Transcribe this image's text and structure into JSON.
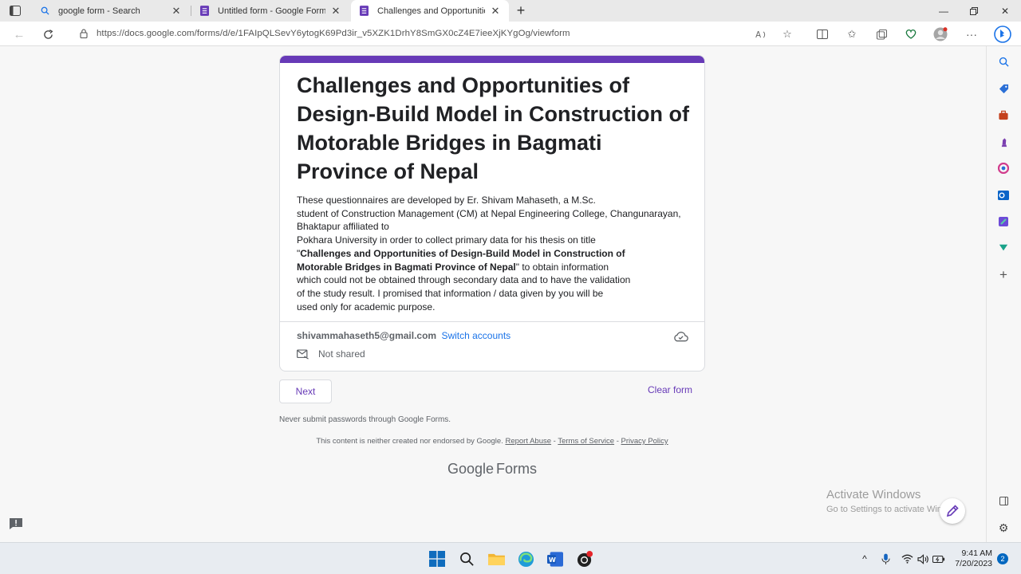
{
  "browser": {
    "tabs": [
      {
        "title": "google form - Search",
        "active": false
      },
      {
        "title": "Untitled form - Google Forms",
        "active": false
      },
      {
        "title": "Challenges and Opportunities of",
        "active": true
      }
    ],
    "new_tab_label": "+",
    "url": "https://docs.google.com/forms/d/e/1FAIpQLSevY6ytogK69Pd3ir_v5XZK1DrhY8SmGX0cZ4E7ieeXjKYgOg/viewform"
  },
  "form": {
    "accent_color": "#673ab7",
    "title": "Challenges and Opportunities of Design-Build Model in Construction of Motorable Bridges in Bagmati Province of Nepal",
    "description": {
      "intro_line1": "These questionnaires are developed by Er. Shivam Mahaseth, a M.Sc.",
      "intro_line2": "student of Construction Management (CM) at Nepal Engineering College, Changunarayan,",
      "intro_line3": "Bhaktapur affiliated to",
      "intro_line4": "Pokhara University in order to collect primary data for his thesis on title",
      "quote_open": "\"",
      "bold_title_line1": "Challenges and Opportunities of Design-Build Model in Construction of",
      "bold_title_line2": "Motorable Bridges in Bagmati Province of Nepal",
      "quote_close": "\"",
      "after_title": " to obtain information",
      "outro_line1": "which could not be obtained through secondary data and to have the validation",
      "outro_line2": "of the study result. I promised that information / data given by you will be",
      "outro_line3": "used only for academic purpose."
    },
    "account": {
      "email": "shivammahaseth5@gmail.com",
      "switch_label": "Switch accounts",
      "share_status": "Not shared"
    },
    "next_label": "Next",
    "clear_label": "Clear form",
    "password_warning": "Never submit passwords through Google Forms.",
    "footer": {
      "disclaimer": "This content is neither created nor endorsed by Google.",
      "report_abuse": "Report Abuse",
      "sep": " - ",
      "terms": "Terms of Service",
      "privacy": "Privacy Policy"
    },
    "logo_google": "Google",
    "logo_forms": "Forms"
  },
  "watermark": {
    "line1": "Activate Windows",
    "line2": "Go to Settings to activate Windows."
  },
  "taskbar": {
    "time": "9:41 AM",
    "date": "7/20/2023",
    "notification_count": "2"
  }
}
